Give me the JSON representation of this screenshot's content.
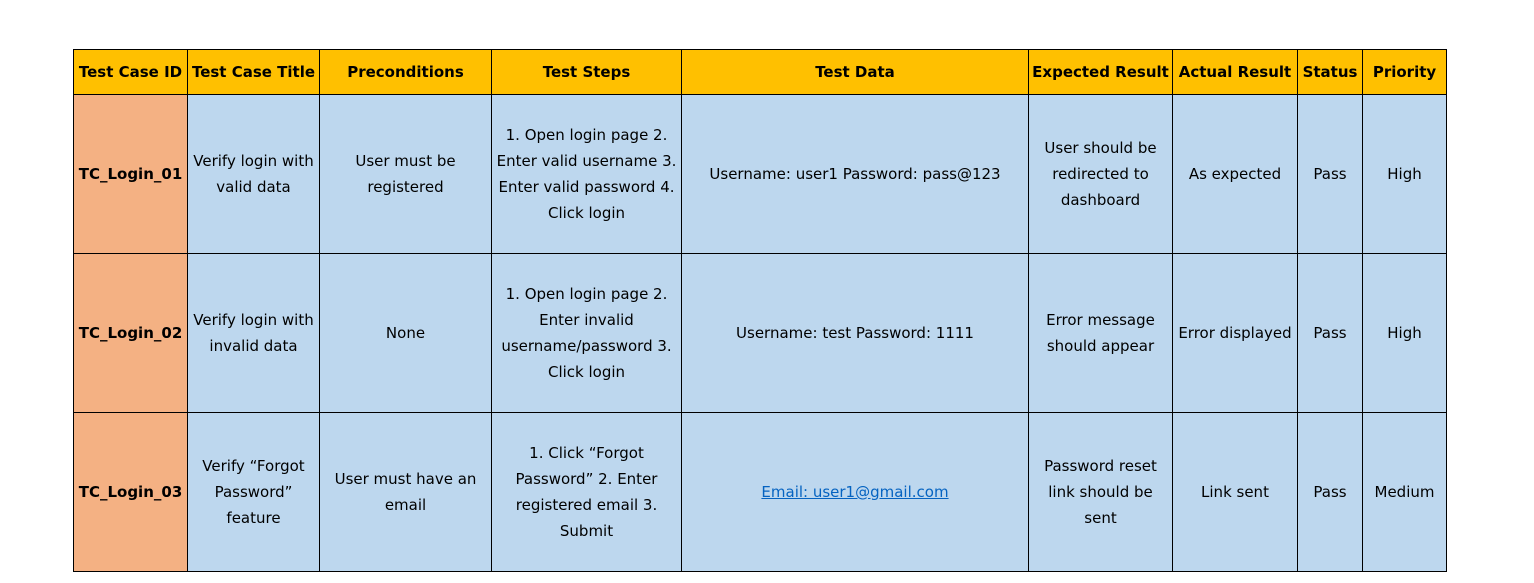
{
  "columns": [
    "Test Case ID",
    "Test Case Title",
    "Preconditions",
    "Test Steps",
    "Test Data",
    "Expected Result",
    "Actual Result",
    "Status",
    "Priority"
  ],
  "rows": [
    {
      "id": "TC_Login_01",
      "title": "Verify login with valid data",
      "preconditions": "User must be registered",
      "steps": "1. Open login page 2. Enter valid username 3. Enter valid password 4. Click login",
      "data": "Username: user1 Password: pass@123",
      "expected": "User should be redirected to dashboard",
      "actual": "As expected",
      "status": "Pass",
      "priority": "High"
    },
    {
      "id": "TC_Login_02",
      "title": "Verify login with invalid data",
      "preconditions": "None",
      "steps": "1. Open login page 2. Enter invalid username/password 3. Click login",
      "data": "Username: test Password: 1111",
      "expected": "Error message should appear",
      "actual": "Error displayed",
      "status": "Pass",
      "priority": "High"
    },
    {
      "id": "TC_Login_03",
      "title": "Verify “Forgot Password” feature",
      "preconditions": "User must have an email",
      "steps": "1. Click “Forgot Password” 2. Enter registered email 3. Submit",
      "data": "Email: user1@gmail.com",
      "expected": "Password reset link should be sent",
      "actual": "Link sent",
      "status": "Pass",
      "priority": "Medium"
    }
  ],
  "colors": {
    "header_bg": "#ffc000",
    "id_cell_bg": "#f4b183",
    "cell_bg": "#bdd7ee",
    "link": "#0563c1"
  }
}
